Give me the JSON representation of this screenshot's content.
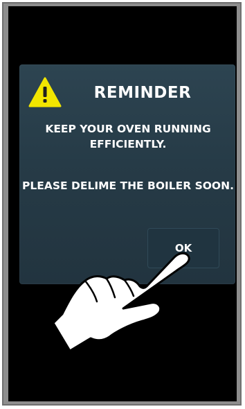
{
  "dialog": {
    "title": "REMINDER",
    "message_line_1": "KEEP YOUR OVEN RUNNING EFFICIENTLY.",
    "message_line_2": "PLEASE DELIME THE BOILER SOON.",
    "ok_label": "OK"
  },
  "icons": {
    "warning": "warning-triangle-icon",
    "hand": "pointing-hand-icon"
  },
  "colors": {
    "screen_background": "#000000",
    "dialog_background": "#2b414e",
    "button_background": "#203440",
    "warning_yellow": "#f2e600",
    "text": "#ffffff",
    "frame": "#8e8e8e"
  }
}
